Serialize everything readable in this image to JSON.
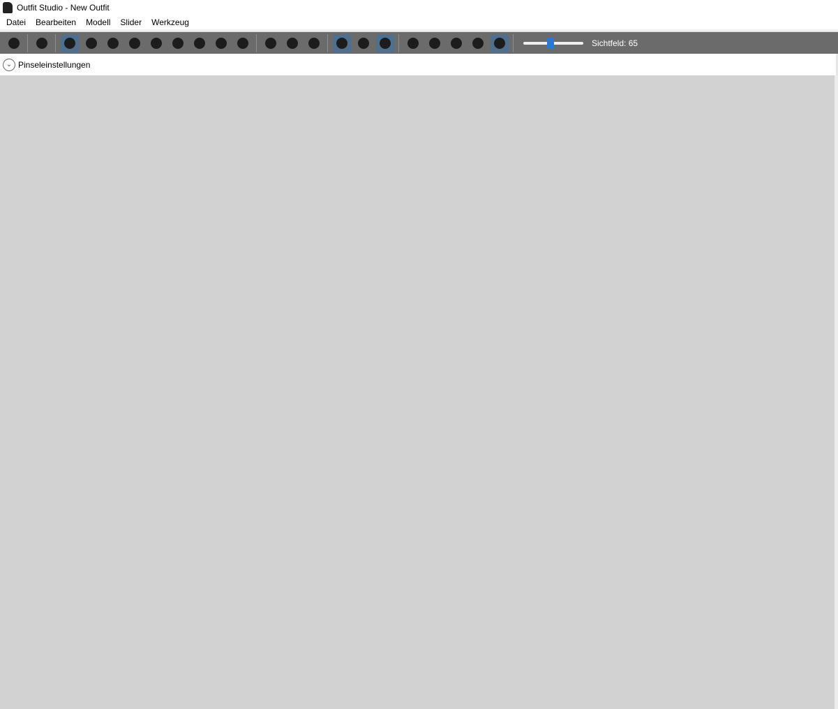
{
  "window": {
    "title": "Outfit Studio - New Outfit"
  },
  "menu": [
    "Datei",
    "Bearbeiten",
    "Modell",
    "Slider",
    "Werkzeug"
  ],
  "toolbar": {
    "groups": [
      [
        "new-outfit-icon"
      ],
      [
        "load-reference-icon"
      ],
      [
        "select-tool-icon",
        "select-rect-tool-icon",
        "brush-inflate-icon",
        "brush-deflate-icon",
        "brush-move-icon",
        "brush-smooth-icon",
        "brush-mask-icon",
        "brush-color-icon",
        "brush-alpha-icon"
      ],
      [
        "transform-tool-icon",
        "pivot-tool-icon",
        "weight-brush-icon"
      ],
      [
        "x-mirror-icon",
        "connected-only-icon",
        "global-brush-icon"
      ],
      [
        "view-front-icon",
        "view-back-icon",
        "view-left-icon",
        "view-right-icon",
        "view-perspective-icon"
      ]
    ],
    "fov_label": "Sichtfeld: 65",
    "fov_value": 65
  },
  "panel": {
    "label": "Pinseleinstellungen"
  },
  "colors": {
    "toolbar_bg": "#6b6b6b",
    "viewport_bg": "#d2d2d2",
    "accent": "#2b78d4"
  }
}
